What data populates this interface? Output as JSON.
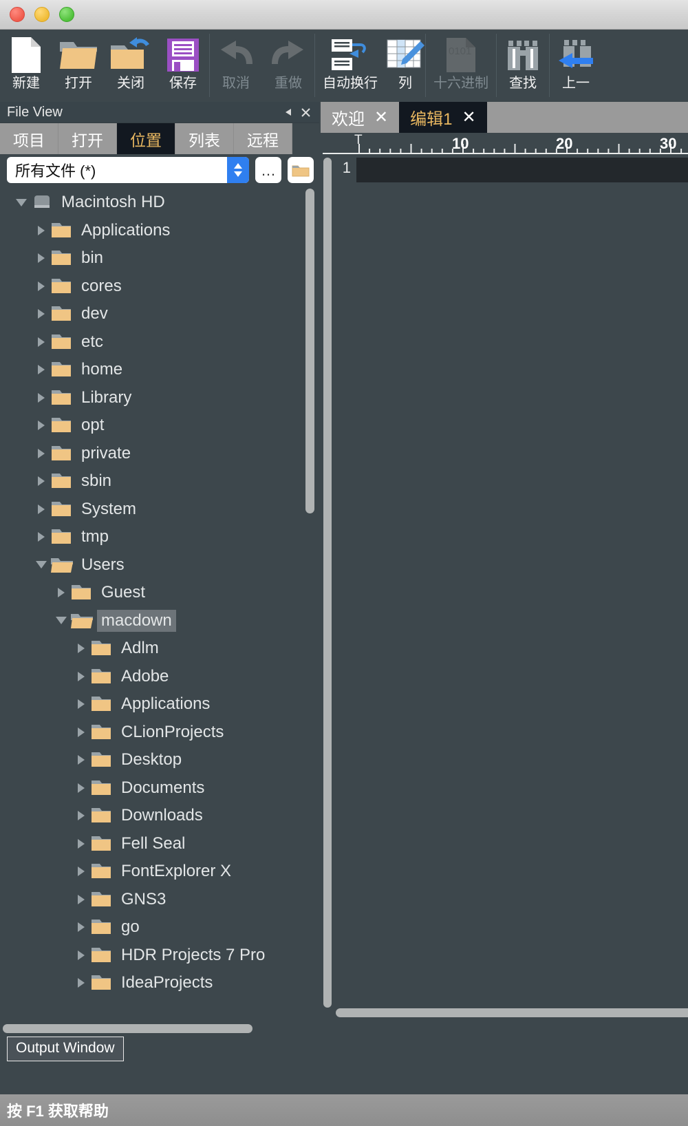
{
  "window": {
    "traffic_lights": [
      "close",
      "minimize",
      "zoom"
    ]
  },
  "toolbar": {
    "items": [
      {
        "label": "新建",
        "icon": "new-document-icon",
        "enabled": true
      },
      {
        "label": "打开",
        "icon": "open-folder-icon",
        "enabled": true
      },
      {
        "label": "关闭",
        "icon": "close-folder-icon",
        "enabled": true
      },
      {
        "label": "保存",
        "icon": "floppy-save-icon",
        "enabled": true
      },
      {
        "label": "取消",
        "icon": "undo-icon",
        "enabled": false
      },
      {
        "label": "重做",
        "icon": "redo-icon",
        "enabled": false
      },
      {
        "label": "自动换行",
        "icon": "word-wrap-icon",
        "enabled": true
      },
      {
        "label": "列",
        "icon": "column-edit-icon",
        "enabled": true
      },
      {
        "label": "十六进制",
        "icon": "hex-view-icon",
        "enabled": false
      },
      {
        "label": "查找",
        "icon": "binoculars-find-icon",
        "enabled": true
      },
      {
        "label": "上一",
        "icon": "find-previous-icon",
        "enabled": true
      }
    ]
  },
  "file_view": {
    "title": "File View",
    "collapse_label": "◀",
    "close_label": "✕",
    "tabs": [
      {
        "label": "项目",
        "active": false
      },
      {
        "label": "打开",
        "active": false
      },
      {
        "label": "位置",
        "active": true
      },
      {
        "label": "列表",
        "active": false
      },
      {
        "label": "远程",
        "active": false
      }
    ],
    "filter": {
      "value": "所有文件 (*)",
      "browse_label": "…"
    },
    "tree": [
      {
        "label": "Macintosh HD",
        "depth": 0,
        "state": "open",
        "icon": "hard-drive-icon",
        "selected": false
      },
      {
        "label": "Applications",
        "depth": 1,
        "state": "collapsed",
        "icon": "folder-icon",
        "selected": false
      },
      {
        "label": "bin",
        "depth": 1,
        "state": "collapsed",
        "icon": "folder-icon",
        "selected": false
      },
      {
        "label": "cores",
        "depth": 1,
        "state": "collapsed",
        "icon": "folder-icon",
        "selected": false
      },
      {
        "label": "dev",
        "depth": 1,
        "state": "collapsed",
        "icon": "folder-icon",
        "selected": false
      },
      {
        "label": "etc",
        "depth": 1,
        "state": "collapsed",
        "icon": "folder-icon",
        "selected": false
      },
      {
        "label": "home",
        "depth": 1,
        "state": "collapsed",
        "icon": "folder-icon",
        "selected": false
      },
      {
        "label": "Library",
        "depth": 1,
        "state": "collapsed",
        "icon": "folder-icon",
        "selected": false
      },
      {
        "label": "opt",
        "depth": 1,
        "state": "collapsed",
        "icon": "folder-icon",
        "selected": false
      },
      {
        "label": "private",
        "depth": 1,
        "state": "collapsed",
        "icon": "folder-icon",
        "selected": false
      },
      {
        "label": "sbin",
        "depth": 1,
        "state": "collapsed",
        "icon": "folder-icon",
        "selected": false
      },
      {
        "label": "System",
        "depth": 1,
        "state": "collapsed",
        "icon": "folder-icon",
        "selected": false
      },
      {
        "label": "tmp",
        "depth": 1,
        "state": "collapsed",
        "icon": "folder-icon",
        "selected": false
      },
      {
        "label": "Users",
        "depth": 1,
        "state": "open",
        "icon": "folder-open-icon",
        "selected": false
      },
      {
        "label": "Guest",
        "depth": 2,
        "state": "collapsed",
        "icon": "folder-icon",
        "selected": false
      },
      {
        "label": "macdown",
        "depth": 2,
        "state": "open",
        "icon": "folder-open-icon",
        "selected": true
      },
      {
        "label": "Adlm",
        "depth": 3,
        "state": "collapsed",
        "icon": "folder-icon",
        "selected": false
      },
      {
        "label": "Adobe",
        "depth": 3,
        "state": "collapsed",
        "icon": "folder-icon",
        "selected": false
      },
      {
        "label": "Applications",
        "depth": 3,
        "state": "collapsed",
        "icon": "folder-icon",
        "selected": false
      },
      {
        "label": "CLionProjects",
        "depth": 3,
        "state": "collapsed",
        "icon": "folder-icon",
        "selected": false
      },
      {
        "label": "Desktop",
        "depth": 3,
        "state": "collapsed",
        "icon": "folder-icon",
        "selected": false
      },
      {
        "label": "Documents",
        "depth": 3,
        "state": "collapsed",
        "icon": "folder-icon",
        "selected": false
      },
      {
        "label": "Downloads",
        "depth": 3,
        "state": "collapsed",
        "icon": "folder-icon",
        "selected": false
      },
      {
        "label": "Fell Seal",
        "depth": 3,
        "state": "collapsed",
        "icon": "folder-icon",
        "selected": false
      },
      {
        "label": "FontExplorer X",
        "depth": 3,
        "state": "collapsed",
        "icon": "folder-icon",
        "selected": false
      },
      {
        "label": "GNS3",
        "depth": 3,
        "state": "collapsed",
        "icon": "folder-icon",
        "selected": false
      },
      {
        "label": "go",
        "depth": 3,
        "state": "collapsed",
        "icon": "folder-icon",
        "selected": false
      },
      {
        "label": "HDR Projects 7 Pro",
        "depth": 3,
        "state": "collapsed",
        "icon": "folder-icon",
        "selected": false
      },
      {
        "label": "IdeaProjects",
        "depth": 3,
        "state": "collapsed",
        "icon": "folder-icon",
        "selected": false
      }
    ]
  },
  "output_panel": {
    "tab_label": "Output Window"
  },
  "editor": {
    "tabs": [
      {
        "label": "欢迎",
        "active": false,
        "close": "✕"
      },
      {
        "label": "编辑1",
        "active": true,
        "close": "✕"
      }
    ],
    "ruler": {
      "marker": "T",
      "labels": [
        "10",
        "20",
        "30"
      ]
    },
    "line_numbers": [
      "1"
    ]
  },
  "status_bar": {
    "text": "按 F1 获取帮助"
  },
  "colors": {
    "panel_bg": "#3d474c",
    "tab_active_bg": "#121820",
    "tab_active_text": "#e8b760",
    "tab_inactive_bg": "#9a9a9a",
    "folder_yellow": "#f0c584",
    "folder_tab_gray": "#9aa3a8",
    "selection_gray": "#6d7479",
    "accent_blue": "#2f7ff0",
    "scrollbar": "#b0b3b3"
  }
}
